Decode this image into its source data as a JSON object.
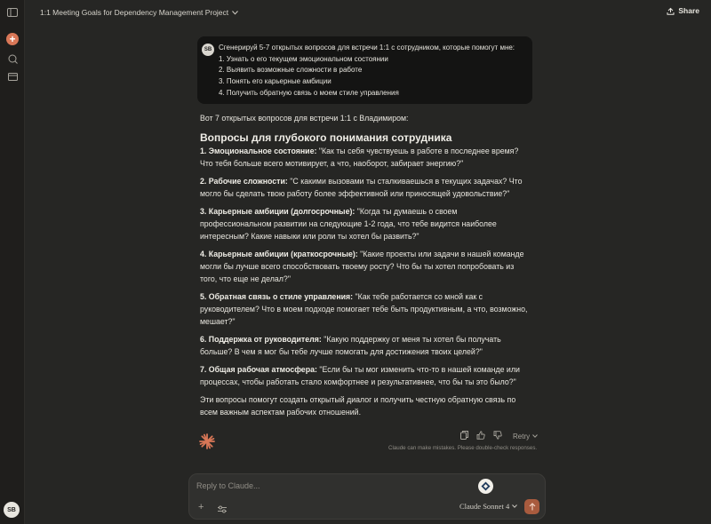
{
  "header": {
    "title": "1:1 Meeting Goals for Dependency Management Project",
    "share_label": "Share"
  },
  "sidebar": {
    "avatar_initials": "SB"
  },
  "user_message": {
    "avatar_initials": "SB",
    "intro": "Сгенерируй 5-7 открытых вопросов для встречи 1:1 с сотрудником, которые помогут мне:",
    "items": [
      "1. Узнать о его текущем эмоциональном состоянии",
      "2. Выявить возможные сложности в работе",
      "3. Понять его карьерные амбиции",
      "4. Получить обратную связь о моем стиле управления"
    ]
  },
  "assistant": {
    "intro": "Вот 7 открытых вопросов для встречи 1:1 с Владимиром:",
    "heading": "Вопросы для глубокого понимания сотрудника",
    "questions": [
      {
        "label": "1. Эмоциональное состояние:",
        "text": " \"Как ты себя чувствуешь в работе в последнее время? Что тебя больше всего мотивирует, а что, наоборот, забирает энергию?\""
      },
      {
        "label": "2. Рабочие сложности:",
        "text": " \"С какими вызовами ты сталкиваешься в текущих задачах? Что могло бы сделать твою работу более эффективной или приносящей удовольствие?\""
      },
      {
        "label": "3. Карьерные амбиции (долгосрочные):",
        "text": " \"Когда ты думаешь о своем профессиональном развитии на следующие 1-2 года, что тебе видится наиболее интересным? Какие навыки или роли ты хотел бы развить?\""
      },
      {
        "label": "4. Карьерные амбиции (краткосрочные):",
        "text": " \"Какие проекты или задачи в нашей команде могли бы лучше всего способствовать твоему росту? Что бы ты хотел попробовать из того, что еще не делал?\""
      },
      {
        "label": "5. Обратная связь о стиле управления:",
        "text": " \"Как тебе работается со мной как с руководителем? Что в моем подходе помогает тебе быть продуктивным, а что, возможно, мешает?\""
      },
      {
        "label": "6. Поддержка от руководителя:",
        "text": " \"Какую поддержку от меня ты хотел бы получать больше? В чем я мог бы тебе лучше помогать для достижения твоих целей?\""
      },
      {
        "label": "7. Общая рабочая атмосфера:",
        "text": " \"Если бы ты мог изменить что-то в нашей команде или процессах, чтобы работать стало комфортнее и результативнее, что бы ты это было?\""
      }
    ],
    "outro": "Эти вопросы помогут создать открытый диалог и получить честную обратную связь по всем важным аспектам рабочих отношений.",
    "retry_label": "Retry",
    "disclaimer": "Claude can make mistakes. Please double-check responses."
  },
  "composer": {
    "placeholder": "Reply to Claude...",
    "model_label": "Claude Sonnet 4"
  },
  "colors": {
    "background": "#262624",
    "accent": "#d97757",
    "send_button": "#a85b3e",
    "user_bubble": "#141413"
  }
}
